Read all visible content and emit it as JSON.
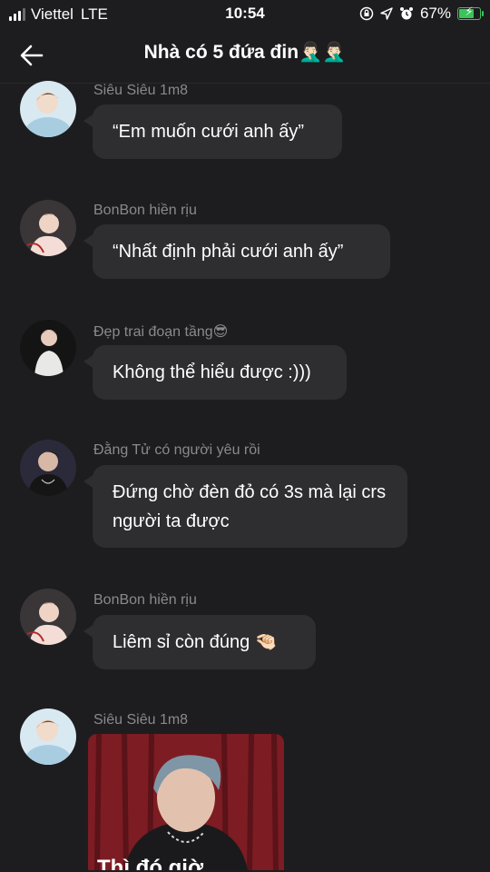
{
  "status_bar": {
    "carrier": "Viettel",
    "network": "LTE",
    "time": "10:54",
    "battery": "67%",
    "battery_level": 0.67,
    "icons": [
      "signal-icon",
      "rotation-lock-icon",
      "location-icon",
      "alarm-icon",
      "battery-icon"
    ]
  },
  "header": {
    "title": "Nhà có 5 đứa đin🤦🏻‍♂️🤦🏻‍♂️",
    "back_icon": "back-arrow-icon"
  },
  "messages": [
    {
      "sender": "Siêu Siêu 1m8",
      "text": "“Em muốn cưới anh ấy”",
      "avatar": "avatar-light"
    },
    {
      "sender": "BonBon hiền rịu",
      "text": "“Nhất định phải cưới anh ấy”",
      "avatar": "avatar-pink"
    },
    {
      "sender": "Đẹp trai đoạn tầng😎",
      "text": "Không thể hiểu được :)))",
      "avatar": "avatar-dark"
    },
    {
      "sender": "Đằng Tử có người yêu rồi",
      "text": "Đứng chờ đèn đỏ có 3s mà lại crs người ta được",
      "avatar": "avatar-moody"
    },
    {
      "sender": "BonBon hiền rịu",
      "text": "Liêm sỉ còn đúng 🤏🏻",
      "avatar": "avatar-pink"
    },
    {
      "sender": "Siêu Siêu 1m8",
      "image_caption": "Thì đó giờ",
      "avatar": "avatar-light"
    }
  ],
  "colors": {
    "background": "#1d1d1f",
    "bubble": "#2e2e30",
    "sender_text": "#8a8a8e",
    "battery": "#3ac45b"
  }
}
